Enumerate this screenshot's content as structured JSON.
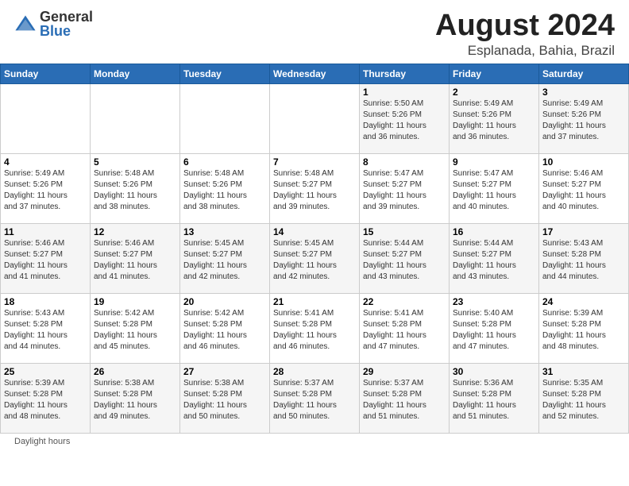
{
  "header": {
    "logo_general": "General",
    "logo_blue": "Blue",
    "main_title": "August 2024",
    "subtitle": "Esplanada, Bahia, Brazil"
  },
  "calendar": {
    "days_of_week": [
      "Sunday",
      "Monday",
      "Tuesday",
      "Wednesday",
      "Thursday",
      "Friday",
      "Saturday"
    ],
    "weeks": [
      [
        {
          "day": "",
          "info": ""
        },
        {
          "day": "",
          "info": ""
        },
        {
          "day": "",
          "info": ""
        },
        {
          "day": "",
          "info": ""
        },
        {
          "day": "1",
          "info": "Sunrise: 5:50 AM\nSunset: 5:26 PM\nDaylight: 11 hours\nand 36 minutes."
        },
        {
          "day": "2",
          "info": "Sunrise: 5:49 AM\nSunset: 5:26 PM\nDaylight: 11 hours\nand 36 minutes."
        },
        {
          "day": "3",
          "info": "Sunrise: 5:49 AM\nSunset: 5:26 PM\nDaylight: 11 hours\nand 37 minutes."
        }
      ],
      [
        {
          "day": "4",
          "info": "Sunrise: 5:49 AM\nSunset: 5:26 PM\nDaylight: 11 hours\nand 37 minutes."
        },
        {
          "day": "5",
          "info": "Sunrise: 5:48 AM\nSunset: 5:26 PM\nDaylight: 11 hours\nand 38 minutes."
        },
        {
          "day": "6",
          "info": "Sunrise: 5:48 AM\nSunset: 5:26 PM\nDaylight: 11 hours\nand 38 minutes."
        },
        {
          "day": "7",
          "info": "Sunrise: 5:48 AM\nSunset: 5:27 PM\nDaylight: 11 hours\nand 39 minutes."
        },
        {
          "day": "8",
          "info": "Sunrise: 5:47 AM\nSunset: 5:27 PM\nDaylight: 11 hours\nand 39 minutes."
        },
        {
          "day": "9",
          "info": "Sunrise: 5:47 AM\nSunset: 5:27 PM\nDaylight: 11 hours\nand 40 minutes."
        },
        {
          "day": "10",
          "info": "Sunrise: 5:46 AM\nSunset: 5:27 PM\nDaylight: 11 hours\nand 40 minutes."
        }
      ],
      [
        {
          "day": "11",
          "info": "Sunrise: 5:46 AM\nSunset: 5:27 PM\nDaylight: 11 hours\nand 41 minutes."
        },
        {
          "day": "12",
          "info": "Sunrise: 5:46 AM\nSunset: 5:27 PM\nDaylight: 11 hours\nand 41 minutes."
        },
        {
          "day": "13",
          "info": "Sunrise: 5:45 AM\nSunset: 5:27 PM\nDaylight: 11 hours\nand 42 minutes."
        },
        {
          "day": "14",
          "info": "Sunrise: 5:45 AM\nSunset: 5:27 PM\nDaylight: 11 hours\nand 42 minutes."
        },
        {
          "day": "15",
          "info": "Sunrise: 5:44 AM\nSunset: 5:27 PM\nDaylight: 11 hours\nand 43 minutes."
        },
        {
          "day": "16",
          "info": "Sunrise: 5:44 AM\nSunset: 5:27 PM\nDaylight: 11 hours\nand 43 minutes."
        },
        {
          "day": "17",
          "info": "Sunrise: 5:43 AM\nSunset: 5:28 PM\nDaylight: 11 hours\nand 44 minutes."
        }
      ],
      [
        {
          "day": "18",
          "info": "Sunrise: 5:43 AM\nSunset: 5:28 PM\nDaylight: 11 hours\nand 44 minutes."
        },
        {
          "day": "19",
          "info": "Sunrise: 5:42 AM\nSunset: 5:28 PM\nDaylight: 11 hours\nand 45 minutes."
        },
        {
          "day": "20",
          "info": "Sunrise: 5:42 AM\nSunset: 5:28 PM\nDaylight: 11 hours\nand 46 minutes."
        },
        {
          "day": "21",
          "info": "Sunrise: 5:41 AM\nSunset: 5:28 PM\nDaylight: 11 hours\nand 46 minutes."
        },
        {
          "day": "22",
          "info": "Sunrise: 5:41 AM\nSunset: 5:28 PM\nDaylight: 11 hours\nand 47 minutes."
        },
        {
          "day": "23",
          "info": "Sunrise: 5:40 AM\nSunset: 5:28 PM\nDaylight: 11 hours\nand 47 minutes."
        },
        {
          "day": "24",
          "info": "Sunrise: 5:39 AM\nSunset: 5:28 PM\nDaylight: 11 hours\nand 48 minutes."
        }
      ],
      [
        {
          "day": "25",
          "info": "Sunrise: 5:39 AM\nSunset: 5:28 PM\nDaylight: 11 hours\nand 48 minutes."
        },
        {
          "day": "26",
          "info": "Sunrise: 5:38 AM\nSunset: 5:28 PM\nDaylight: 11 hours\nand 49 minutes."
        },
        {
          "day": "27",
          "info": "Sunrise: 5:38 AM\nSunset: 5:28 PM\nDaylight: 11 hours\nand 50 minutes."
        },
        {
          "day": "28",
          "info": "Sunrise: 5:37 AM\nSunset: 5:28 PM\nDaylight: 11 hours\nand 50 minutes."
        },
        {
          "day": "29",
          "info": "Sunrise: 5:37 AM\nSunset: 5:28 PM\nDaylight: 11 hours\nand 51 minutes."
        },
        {
          "day": "30",
          "info": "Sunrise: 5:36 AM\nSunset: 5:28 PM\nDaylight: 11 hours\nand 51 minutes."
        },
        {
          "day": "31",
          "info": "Sunrise: 5:35 AM\nSunset: 5:28 PM\nDaylight: 11 hours\nand 52 minutes."
        }
      ]
    ]
  },
  "footer": {
    "daylight_label": "Daylight hours"
  }
}
